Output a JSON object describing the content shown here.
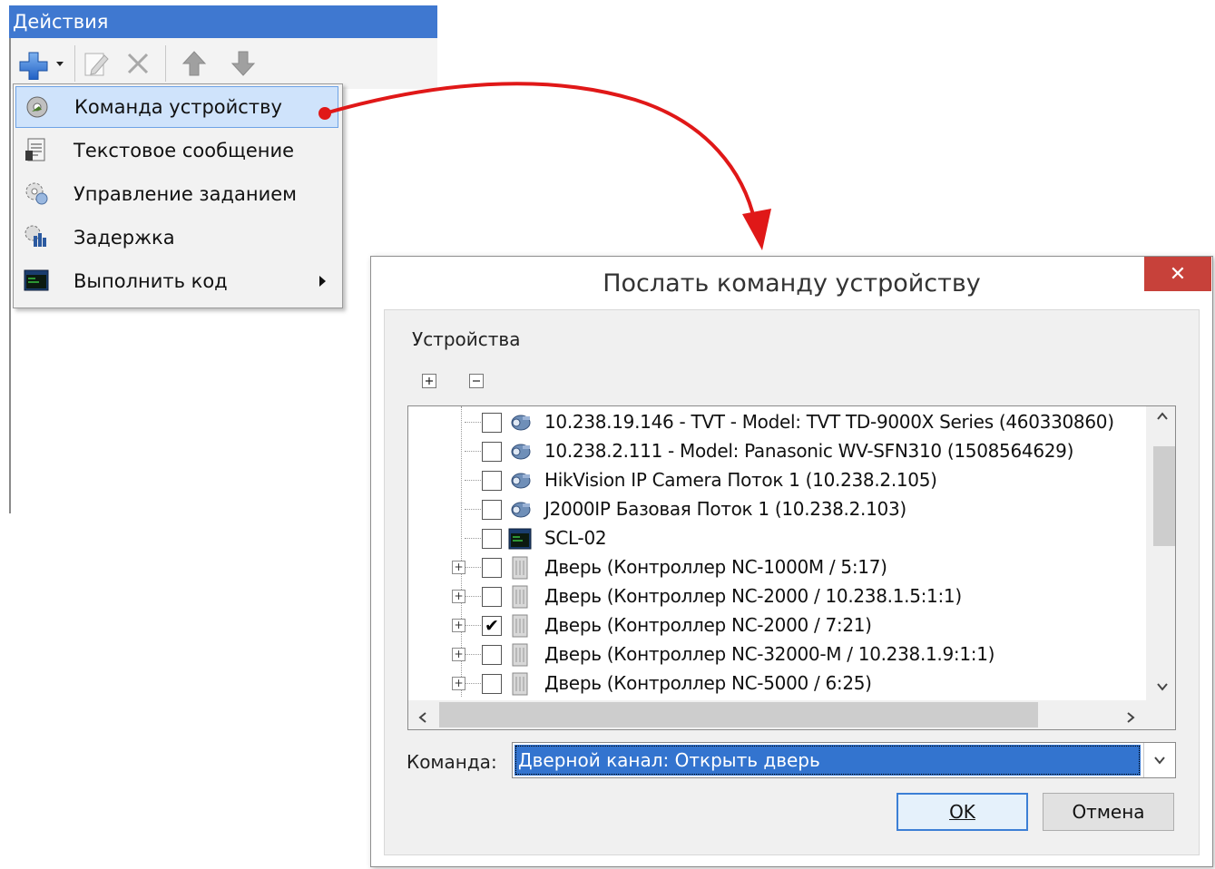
{
  "panel": {
    "title": "Действия",
    "toolbar": [
      "add-icon",
      "edit-icon",
      "delete-icon",
      "move-up-icon",
      "move-down-icon"
    ]
  },
  "menu": {
    "items": [
      {
        "label": "Команда устройству",
        "icon": "device-command-icon",
        "highlighted": true
      },
      {
        "label": "Текстовое сообщение",
        "icon": "text-message-icon"
      },
      {
        "label": "Управление заданием",
        "icon": "task-control-icon"
      },
      {
        "label": "Задержка",
        "icon": "delay-icon"
      },
      {
        "label": "Выполнить код",
        "icon": "run-code-icon",
        "has_submenu": true
      }
    ]
  },
  "dialog": {
    "title": "Послать команду устройству",
    "group_label": "Устройства",
    "expand_all": "+",
    "collapse_all": "−",
    "devices": [
      {
        "label": "10.238.19.146 - TVT - Model: TVT TD-9000X Series (460330860)",
        "icon": "camera-icon",
        "checked": false,
        "expandable": false
      },
      {
        "label": "10.238.2.111 - Model: Panasonic WV-SFN310 (1508564629)",
        "icon": "camera-icon",
        "checked": false,
        "expandable": false
      },
      {
        "label": "HikVision IP Camera Поток 1 (10.238.2.105)",
        "icon": "camera-icon",
        "checked": false,
        "expandable": false
      },
      {
        "label": "J2000IP Базовая Поток 1 (10.238.2.103)",
        "icon": "camera-icon",
        "checked": false,
        "expandable": false
      },
      {
        "label": "SCL-02",
        "icon": "terminal-icon",
        "checked": false,
        "expandable": false
      },
      {
        "label": "Дверь (Контроллер NC-1000M / 5:17)",
        "icon": "door-icon",
        "checked": false,
        "expandable": true
      },
      {
        "label": "Дверь (Контроллер NC-2000 / 10.238.1.5:1:1)",
        "icon": "door-icon",
        "checked": false,
        "expandable": true
      },
      {
        "label": "Дверь (Контроллер NC-2000 / 7:21)",
        "icon": "door-icon",
        "checked": true,
        "expandable": true
      },
      {
        "label": "Дверь (Контроллер NC-32000-M / 10.238.1.9:1:1)",
        "icon": "door-icon",
        "checked": false,
        "expandable": true
      },
      {
        "label": "Дверь (Контроллер NC-5000 / 6:25)",
        "icon": "door-icon",
        "checked": false,
        "expandable": true
      }
    ],
    "command_label": "Команда:",
    "command_value": "Дверной канал: Открыть дверь",
    "ok_label": "OK",
    "cancel_label": "Отмена",
    "close_glyph": "✕"
  },
  "colors": {
    "accent": "#3f78d0",
    "selection": "#3374cf",
    "close": "#c7413a",
    "arrow": "#e01818"
  }
}
